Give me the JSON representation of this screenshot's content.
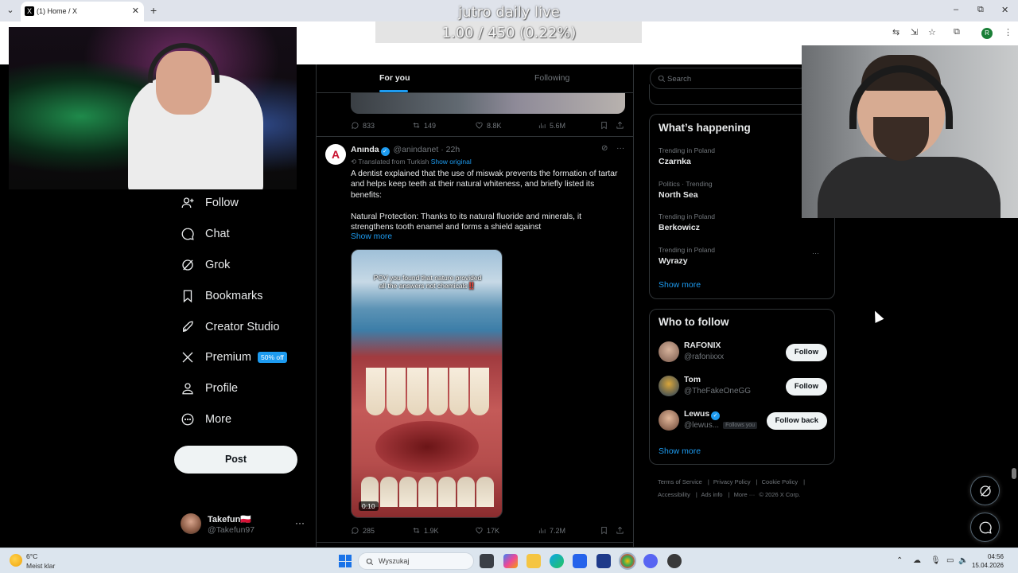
{
  "browser": {
    "tab_title": "(1) Home / X",
    "new_tab": "+",
    "tab_close": "✕",
    "tab_list": "⌄",
    "window_controls": [
      "–",
      "⧉",
      "✕"
    ],
    "profile_initial": "R"
  },
  "overlay": {
    "title": "jutro daily live",
    "counter": "1.00 / 450 (0.22%)"
  },
  "nav": {
    "items": [
      {
        "label": "Follow",
        "icon": "follow-icon"
      },
      {
        "label": "Chat",
        "icon": "chat-icon"
      },
      {
        "label": "Grok",
        "icon": "grok-icon"
      },
      {
        "label": "Bookmarks",
        "icon": "bookmark-icon"
      },
      {
        "label": "Creator Studio",
        "icon": "rocket-icon"
      },
      {
        "label": "Premium",
        "icon": "x-logo-icon",
        "badge": "50% off"
      },
      {
        "label": "Profile",
        "icon": "profile-icon"
      },
      {
        "label": "More",
        "icon": "more-circle-icon"
      }
    ],
    "post_label": "Post",
    "account": {
      "name": "Takefun🇵🇱",
      "handle": "@Takefun97",
      "more": "···"
    }
  },
  "timeline": {
    "tabs": {
      "for_you": "For you",
      "following": "Following"
    },
    "prev_stats": {
      "replies": "833",
      "reposts": "149",
      "likes": "8.8K",
      "views": "5.6M"
    },
    "tweet": {
      "avatar_letter": "A",
      "name": "Anında",
      "handle": "@anindanet",
      "time": "· 22h",
      "translated": "Translated from Turkish",
      "show_original": "Show original",
      "text_p1": "A dentist explained that the use of miswak prevents the formation of tartar and helps keep teeth at their natural whiteness, and briefly listed its benefits:",
      "text_p2": "Natural Protection: Thanks to its natural fluoride and minerals, it strengthens tooth enamel and forms a shield against",
      "show_more": "Show more",
      "media_caption": "POV you found that nature provided all the answers not chemicals‼️",
      "media_duration": "0:10",
      "stats": {
        "replies": "285",
        "reposts": "1.9K",
        "likes": "17K",
        "views": "7.2M"
      }
    }
  },
  "sidebar": {
    "search_placeholder": "Search",
    "happening": {
      "title": "What’s happening",
      "trends": [
        {
          "meta": "Trending in Poland",
          "name": "Czarnka"
        },
        {
          "meta": "Politics · Trending",
          "name": "North Sea"
        },
        {
          "meta": "Trending in Poland",
          "name": "Berkowicz"
        },
        {
          "meta": "Trending in Poland",
          "name": "Wyrazy"
        }
      ],
      "trend_more": "···",
      "show_more": "Show more"
    },
    "who_to_follow": {
      "title": "Who to follow",
      "users": [
        {
          "name": "RAFONIX",
          "handle": "@rafonixxx",
          "button": "Follow",
          "verified": false,
          "follows_you": ""
        },
        {
          "name": "Tom",
          "handle": "@TheFakeOneGG",
          "button": "Follow",
          "verified": false,
          "follows_you": ""
        },
        {
          "name": "Lewus",
          "handle": "@lewus...",
          "button": "Follow back",
          "verified": true,
          "follows_you": "Follows you"
        }
      ],
      "show_more": "Show more"
    },
    "footer": [
      "Terms of Service",
      "Privacy Policy",
      "Cookie Policy",
      "Accessibility",
      "Ads info",
      "More ···",
      "© 2026 X Corp."
    ]
  },
  "taskbar": {
    "weather_temp": "6°C",
    "weather_desc": "Meist klar",
    "search_label": "Wyszukaj",
    "time": "04:56",
    "date": "15.04.2026"
  },
  "colors": {
    "accent": "#1d9bf0",
    "background": "#000000",
    "text": "#e7e9ea",
    "muted": "#71767b"
  }
}
